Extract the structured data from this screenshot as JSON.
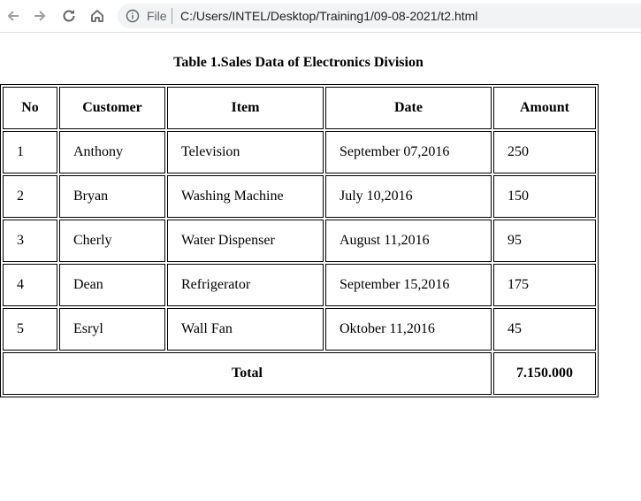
{
  "browser": {
    "file_label": "File",
    "url": "C:/Users/INTEL/Desktop/Training1/09-08-2021/t2.html",
    "icons": [
      "back-arrow-icon",
      "forward-arrow-icon",
      "reload-icon",
      "home-icon",
      "info-icon"
    ]
  },
  "table": {
    "caption": "Table 1.Sales Data of Electronics Division",
    "headers": [
      "No",
      "Customer",
      "Item",
      "Date",
      "Amount"
    ],
    "rows": [
      [
        "1",
        "Anthony",
        "Television",
        "September 07,2016",
        "250"
      ],
      [
        "2",
        "Bryan",
        "Washing Machine",
        "July 10,2016",
        "150"
      ],
      [
        "3",
        "Cherly",
        "Water Dispenser",
        "August 11,2016",
        "95"
      ],
      [
        "4",
        "Dean",
        "Refrigerator",
        "September 15,2016",
        "175"
      ],
      [
        "5",
        "Esryl",
        "Wall Fan",
        "Oktober 11,2016",
        "45"
      ]
    ],
    "total_label": "Total",
    "total_value": "7.150.000"
  }
}
